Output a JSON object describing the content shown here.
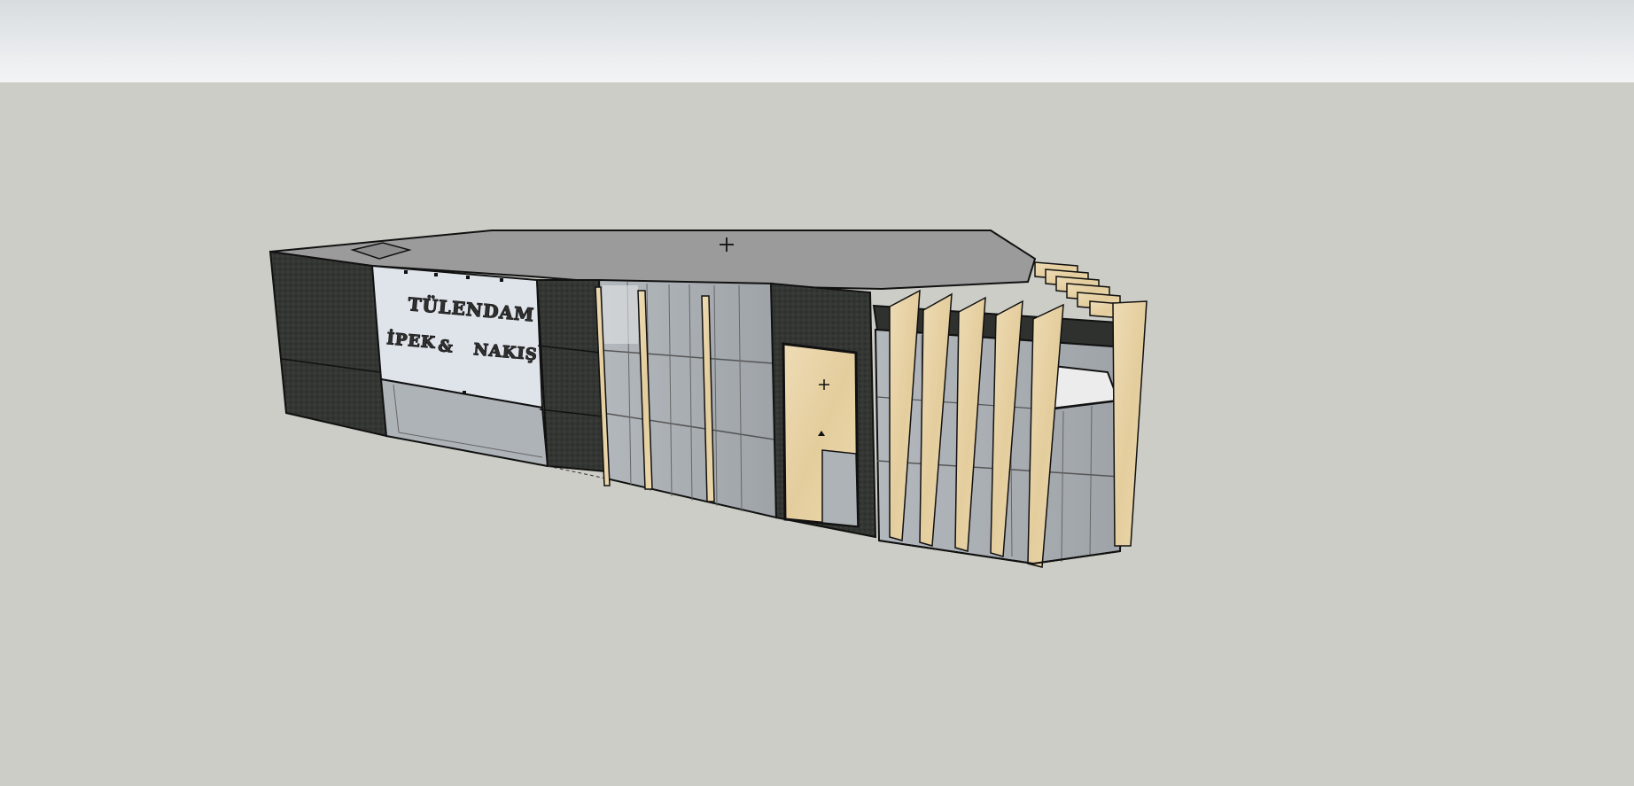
{
  "scene": {
    "sky_color": "#e5e8ea",
    "ground_color": "#cdcdc7",
    "roof_color": "#9b9b9b",
    "cladding_color": "#333532",
    "glass_color": "#a9aeb3",
    "timber_color": "#e8d3a6",
    "sign_panel_color": "#dfe3ea"
  },
  "signage": {
    "line1": "TÜLENDAM",
    "line2_word1": "İPEK",
    "line2_amp": "&",
    "line2_word2": "NAKIŞ"
  },
  "icons": [
    "crosshair-icon"
  ]
}
